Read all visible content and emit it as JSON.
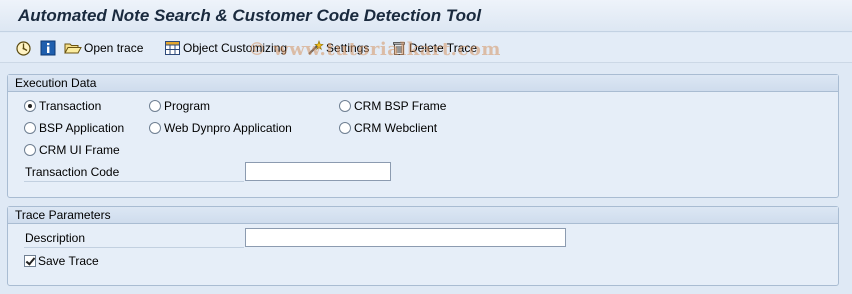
{
  "window": {
    "title": "Automated Note Search & Customer Code Detection Tool"
  },
  "toolbar": {
    "items": [
      {
        "label": "",
        "icon": "execute-icon"
      },
      {
        "label": "",
        "icon": "info-icon"
      },
      {
        "label": "Open trace",
        "icon": "open-folder-icon"
      },
      {
        "label": "Object Customizing",
        "icon": "grid-icon"
      },
      {
        "label": "Settings",
        "icon": "settings-wand-icon"
      },
      {
        "label": "Delete Trace",
        "icon": "trash-icon"
      }
    ]
  },
  "watermark": "© www.tutorialkart.com",
  "execution": {
    "title": "Execution Data",
    "options": [
      {
        "label": "Transaction",
        "selected": true
      },
      {
        "label": "Program",
        "selected": false
      },
      {
        "label": "CRM BSP Frame",
        "selected": false
      },
      {
        "label": "BSP Application",
        "selected": false
      },
      {
        "label": "Web Dynpro Application",
        "selected": false
      },
      {
        "label": "CRM Webclient",
        "selected": false
      },
      {
        "label": "CRM UI Frame",
        "selected": false
      }
    ],
    "transaction_code": {
      "label": "Transaction Code",
      "value": ""
    }
  },
  "trace": {
    "title": "Trace Parameters",
    "description": {
      "label": "Description",
      "value": ""
    },
    "save_trace": {
      "label": "Save Trace",
      "checked": true
    }
  },
  "colors": {
    "background": "#dfe9f5",
    "group_border": "#a9bcd2",
    "title_text": "#1a2a3e"
  }
}
